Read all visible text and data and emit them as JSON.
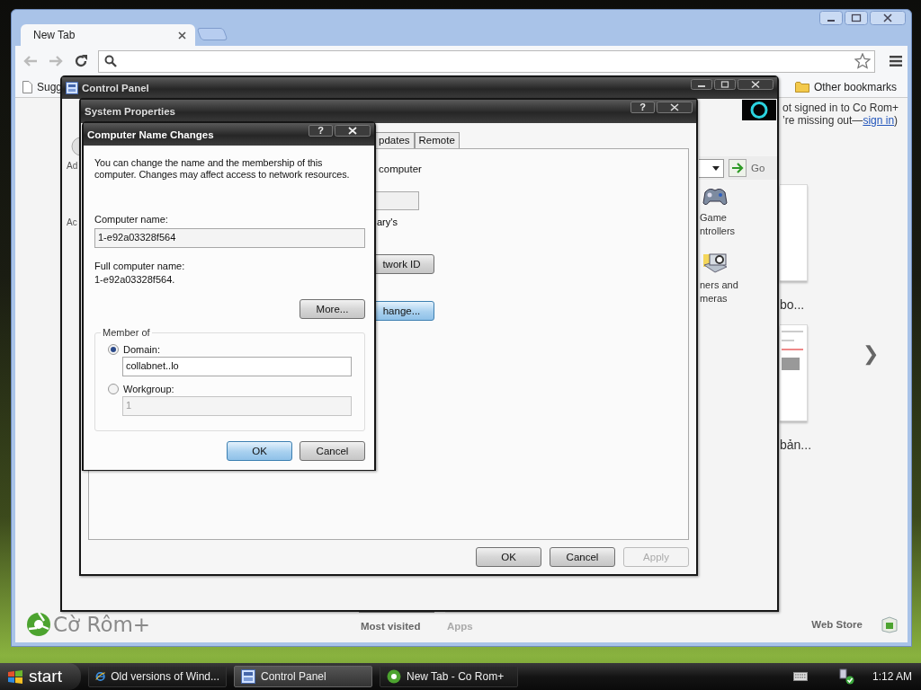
{
  "browser": {
    "tabs": [
      {
        "label": "New Tab",
        "selected": true
      }
    ],
    "bookmarks": [
      "Sugg"
    ],
    "other_bookmarks": "Other bookmarks",
    "signin": {
      "line1": "ot signed in to Co Rom+",
      "line2": "’re missing out—",
      "link": "sign in",
      "tail": ")"
    },
    "thumbnails": [
      {
        "caption": "bo..."
      },
      {
        "caption": "bản..."
      }
    ],
    "next": "❯",
    "logo": "Cờ Rôm+",
    "sections": [
      {
        "label": "Most visited",
        "selected": true
      },
      {
        "label": "Apps",
        "selected": false
      }
    ],
    "web_store": "Web Store"
  },
  "control_panel": {
    "title": "Control Panel",
    "labels": [
      "Ad",
      "Ac"
    ],
    "go": "Go",
    "items": [
      {
        "lines": [
          "Game",
          "ntrollers"
        ],
        "kind": "gamepad"
      },
      {
        "lines": [
          "ners and",
          "meras"
        ],
        "kind": "camera"
      }
    ]
  },
  "system_properties": {
    "title": "System Properties",
    "help": "?",
    "tabs": [
      {
        "label": "pdates",
        "selected": false
      },
      {
        "label": "Remote",
        "selected": false
      }
    ],
    "description": "computer",
    "owner": "ary's",
    "buttons": [
      {
        "label": "twork ID",
        "focused": false
      },
      {
        "label": "hange...",
        "focused": true
      }
    ],
    "footer_buttons": [
      {
        "label": "OK",
        "disabled": false
      },
      {
        "label": "Cancel",
        "disabled": false
      },
      {
        "label": "Apply",
        "disabled": true
      }
    ]
  },
  "dialog": {
    "title": "Computer Name Changes",
    "help": "?",
    "intro": "You can change the name and the membership of this computer. Changes may affect access to network resources.",
    "computer_name_label": "Computer name:",
    "computer_name": "1-e92a03328f564",
    "full_name_label": "Full computer name:",
    "full_name": "1-e92a03328f564.",
    "more": "More...",
    "member_of": "Member of",
    "options": [
      {
        "label": "Domain:",
        "selected": true,
        "value": "collabnet..lo",
        "disabled": false
      },
      {
        "label": "Workgroup:",
        "selected": false,
        "value": "1",
        "disabled": true
      }
    ],
    "buttons": [
      {
        "label": "OK",
        "default": true
      },
      {
        "label": "Cancel",
        "default": false
      }
    ]
  },
  "taskbar": {
    "start": "start",
    "items": [
      {
        "label": "Old versions of Wind...",
        "kind": "browser",
        "selected": false
      },
      {
        "label": "Control Panel",
        "kind": "settings",
        "selected": true
      },
      {
        "label": "New Tab - Co Rom+",
        "kind": "browser2",
        "selected": false
      }
    ],
    "clock": "1:12 AM"
  }
}
